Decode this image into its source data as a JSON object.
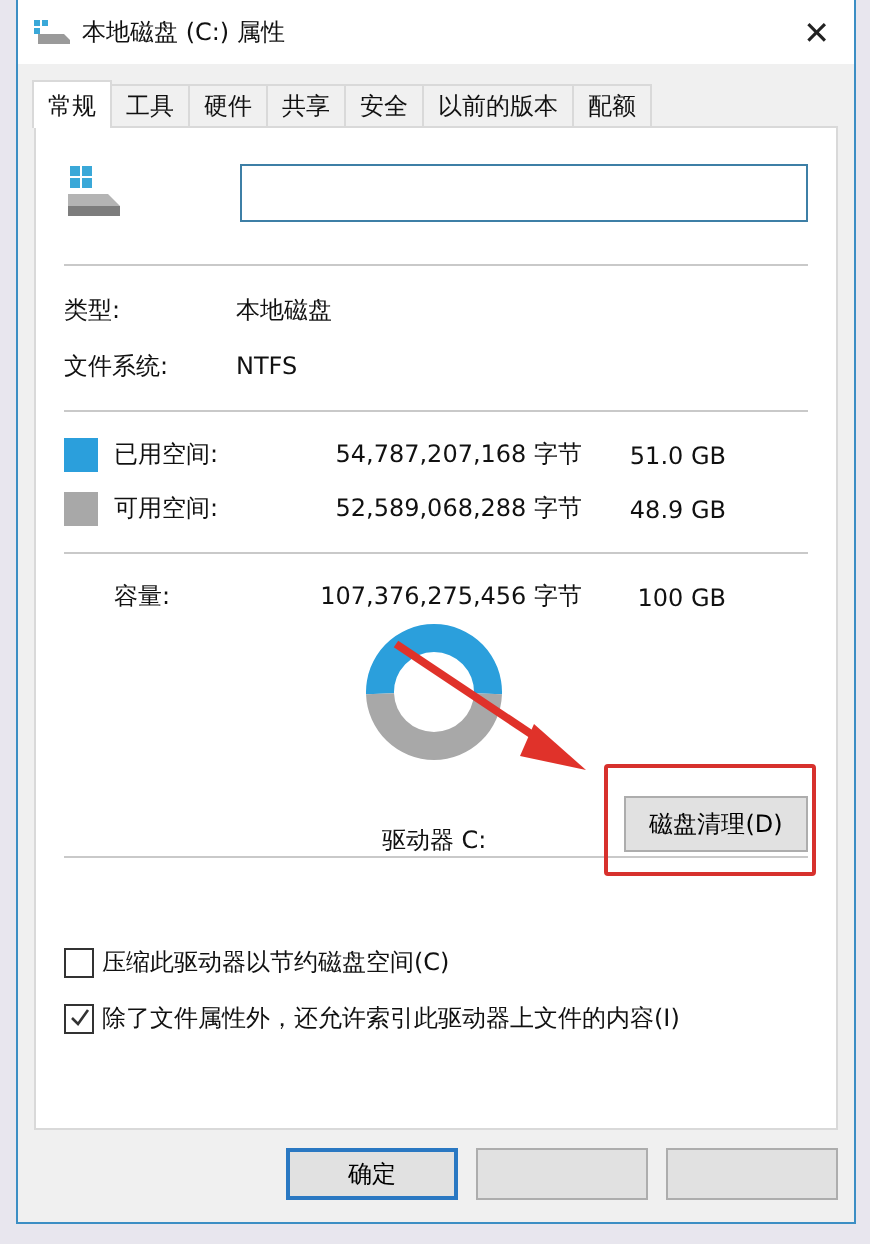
{
  "window": {
    "title": "本地磁盘 (C:) 属性",
    "close": "✕"
  },
  "tabs": [
    {
      "label": "常规",
      "selected": true
    },
    {
      "label": "工具",
      "selected": false
    },
    {
      "label": "硬件",
      "selected": false
    },
    {
      "label": "共享",
      "selected": false
    },
    {
      "label": "安全",
      "selected": false
    },
    {
      "label": "以前的版本",
      "selected": false
    },
    {
      "label": "配额",
      "selected": false
    }
  ],
  "info": [
    {
      "label": "类型:",
      "value": "本地磁盘"
    },
    {
      "label": "文件系统:",
      "value": "NTFS"
    }
  ],
  "space": [
    {
      "label": "已用空间:",
      "bytes": "54,787,207,168 字节",
      "size": "51.0 GB",
      "color": "#2b9fdc"
    },
    {
      "label": "可用空间:",
      "bytes": "52,589,068,288 字节",
      "size": "48.9 GB",
      "color": "#a8a8a8"
    }
  ],
  "capacity": {
    "label": "容量:",
    "bytes": "107,376,275,456 字节",
    "size": "100 GB"
  },
  "chart_data": {
    "type": "donut",
    "values": [
      51.0,
      48.9
    ]
  },
  "drive_label": "驱动器 C:",
  "cleanup_button": "磁盘清理(D)",
  "options": [
    {
      "label": "压缩此驱动器以节约磁盘空间(C)",
      "checked": false
    },
    {
      "label": "除了文件属性外，还允许索引此驱动器上文件的内容(I)",
      "checked": true
    }
  ],
  "buttons": [
    {
      "label": "确定",
      "default": true
    },
    {
      "default": false
    },
    {
      "default": false
    }
  ]
}
